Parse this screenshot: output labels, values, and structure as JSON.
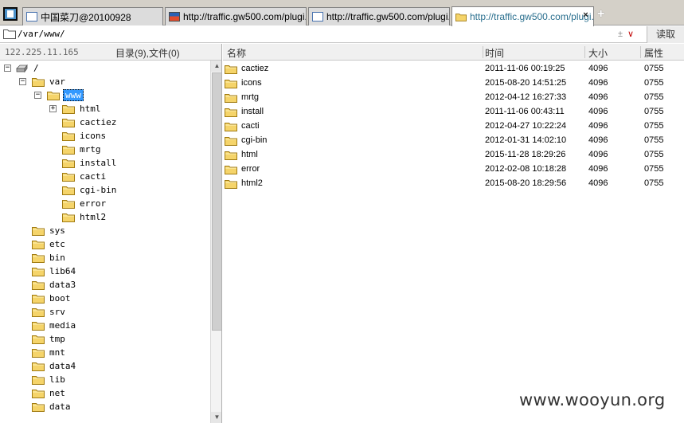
{
  "tabs": [
    {
      "label": "中国菜刀@20100928",
      "icon": "page-icon",
      "active": false
    },
    {
      "label": "http://traffic.gw500.com/plugi...",
      "icon": "flag-icon",
      "active": false
    },
    {
      "label": "http://traffic.gw500.com/plugi...",
      "icon": "page-icon",
      "active": false
    },
    {
      "label": "http://traffic.gw500.com/plugi...",
      "icon": "folder-icon",
      "active": true
    }
  ],
  "tab_close_glyph": "×",
  "add_tab_glyph": "+",
  "address": {
    "path": "/var/www/",
    "tools": "±",
    "dropdown_glyph": "∨",
    "read_button": "读取"
  },
  "left": {
    "ip": "122.225.11.165",
    "summary": "目录(9),文件(0)",
    "tree": [
      {
        "label": "/",
        "icon": "drive-icon",
        "expander": "−"
      },
      {
        "label": "var",
        "icon": "folder-icon",
        "expander": "−"
      },
      {
        "label": "www",
        "icon": "folder-icon",
        "expander": "−",
        "selected": true
      },
      {
        "label": "html",
        "icon": "folder-icon",
        "expander": "+"
      },
      {
        "label": "cactiez",
        "icon": "folder-icon"
      },
      {
        "label": "icons",
        "icon": "folder-icon"
      },
      {
        "label": "mrtg",
        "icon": "folder-icon"
      },
      {
        "label": "install",
        "icon": "folder-icon"
      },
      {
        "label": "cacti",
        "icon": "folder-icon"
      },
      {
        "label": "cgi-bin",
        "icon": "folder-icon"
      },
      {
        "label": "error",
        "icon": "folder-icon"
      },
      {
        "label": "html2",
        "icon": "folder-icon"
      },
      {
        "label": "sys",
        "icon": "folder-icon"
      },
      {
        "label": "etc",
        "icon": "folder-icon"
      },
      {
        "label": "bin",
        "icon": "folder-icon"
      },
      {
        "label": "lib64",
        "icon": "folder-icon"
      },
      {
        "label": "data3",
        "icon": "folder-icon"
      },
      {
        "label": "boot",
        "icon": "folder-icon"
      },
      {
        "label": "srv",
        "icon": "folder-icon"
      },
      {
        "label": "media",
        "icon": "folder-icon"
      },
      {
        "label": "tmp",
        "icon": "folder-icon"
      },
      {
        "label": "mnt",
        "icon": "folder-icon"
      },
      {
        "label": "data4",
        "icon": "folder-icon"
      },
      {
        "label": "lib",
        "icon": "folder-icon"
      },
      {
        "label": "net",
        "icon": "folder-icon"
      },
      {
        "label": "data",
        "icon": "folder-icon"
      }
    ]
  },
  "files": {
    "columns": [
      "名称",
      "时间",
      "大小",
      "属性"
    ],
    "rows": [
      {
        "name": "cactiez",
        "time": "2011-11-06 00:19:25",
        "size": "4096",
        "attr": "0755"
      },
      {
        "name": "icons",
        "time": "2015-08-20 14:51:25",
        "size": "4096",
        "attr": "0755"
      },
      {
        "name": "mrtg",
        "time": "2012-04-12 16:27:33",
        "size": "4096",
        "attr": "0755"
      },
      {
        "name": "install",
        "time": "2011-11-06 00:43:11",
        "size": "4096",
        "attr": "0755"
      },
      {
        "name": "cacti",
        "time": "2012-04-27 10:22:24",
        "size": "4096",
        "attr": "0755"
      },
      {
        "name": "cgi-bin",
        "time": "2012-01-31 14:02:10",
        "size": "4096",
        "attr": "0755"
      },
      {
        "name": "html",
        "time": "2015-11-28 18:29:26",
        "size": "4096",
        "attr": "0755"
      },
      {
        "name": "error",
        "time": "2012-02-08 10:18:28",
        "size": "4096",
        "attr": "0755"
      },
      {
        "name": "html2",
        "time": "2015-08-20 18:29:56",
        "size": "4096",
        "attr": "0755"
      }
    ]
  },
  "watermark": "www.wooyun.org",
  "colors": {
    "selection": "#3399ff",
    "folder": "#f5d46a",
    "active_tab_text": "#2a6f8e"
  }
}
